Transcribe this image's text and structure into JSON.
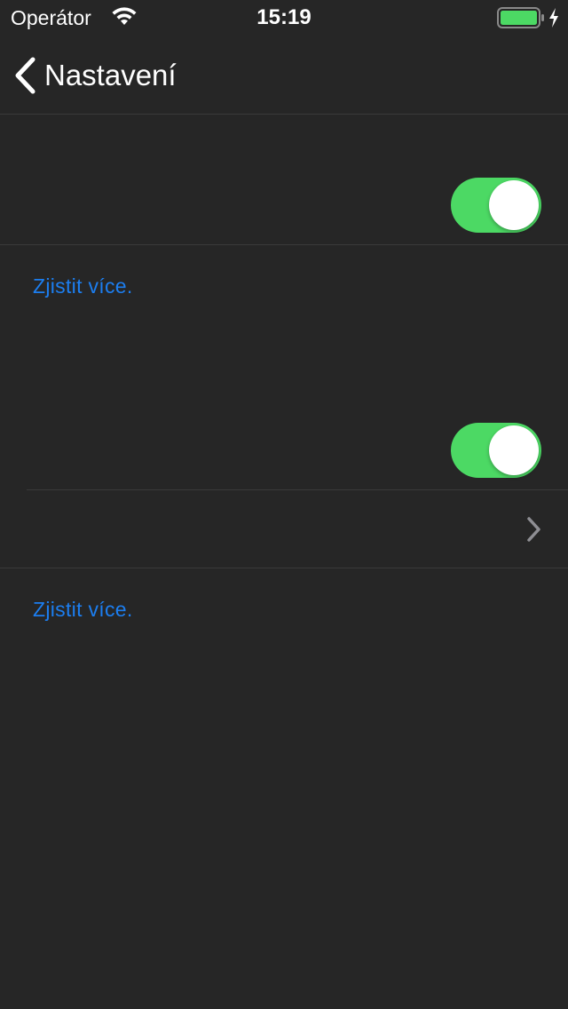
{
  "status_bar": {
    "carrier": "Operátor",
    "time": "15:19",
    "battery_color": "#4cd964"
  },
  "nav": {
    "back_label": "Nastavení"
  },
  "section1": {
    "toggle_on": true,
    "footer_link": "Zjistit více."
  },
  "section2": {
    "toggle_on": true,
    "footer_link": "Zjistit více."
  },
  "colors": {
    "background": "#262626",
    "separator": "#3a3a3a",
    "toggle_on": "#4cd964",
    "link": "#1c7ef0"
  }
}
